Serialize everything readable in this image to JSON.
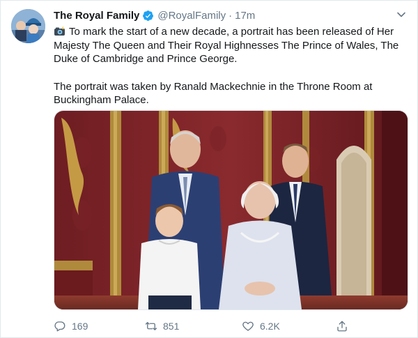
{
  "author": {
    "display_name": "The Royal Family",
    "handle": "@RoyalFamily",
    "separator": "·",
    "time": "17m",
    "verified": true
  },
  "tweet": {
    "paragraph1": "To mark the start of a new decade, a portrait has been released of Her Majesty The Queen and Their Royal Highnesses The Prince of Wales, The Duke of Cambridge and Prince George.",
    "paragraph2": "The portrait was taken by Ranald Mackechnie in the Throne Room at Buckingham Palace.",
    "emoji": "camera-with-flash"
  },
  "media": {
    "description_icon": "photo"
  },
  "actions": {
    "reply_count": "169",
    "retweet_count": "851",
    "like_count": "6.2K"
  },
  "colors": {
    "text": "#14171a",
    "secondary": "#657786",
    "verified": "#1da1f2",
    "border": "#e1e8ed"
  }
}
